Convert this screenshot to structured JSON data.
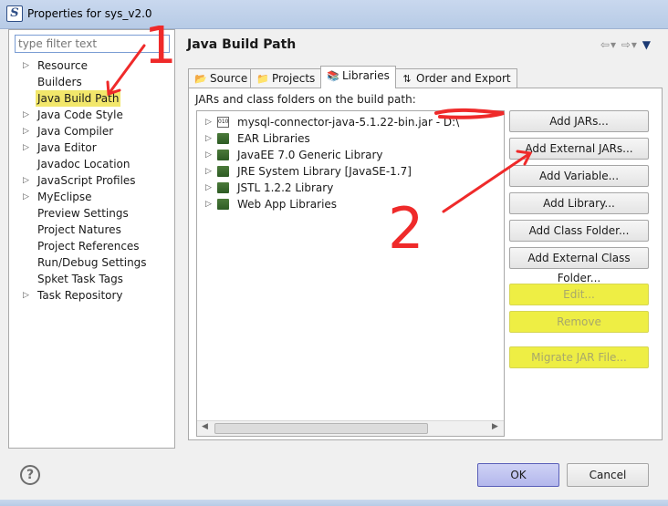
{
  "window": {
    "title": "Properties for sys_v2.0"
  },
  "filter": {
    "placeholder": "type filter text"
  },
  "tree": [
    {
      "label": "Resource",
      "expandable": true
    },
    {
      "label": "Builders",
      "expandable": false
    },
    {
      "label": "Java Build Path",
      "expandable": false,
      "selected": true
    },
    {
      "label": "Java Code Style",
      "expandable": true
    },
    {
      "label": "Java Compiler",
      "expandable": true
    },
    {
      "label": "Java Editor",
      "expandable": true
    },
    {
      "label": "Javadoc Location",
      "expandable": false
    },
    {
      "label": "JavaScript Profiles",
      "expandable": true
    },
    {
      "label": "MyEclipse",
      "expandable": true
    },
    {
      "label": "Preview Settings",
      "expandable": false
    },
    {
      "label": "Project Natures",
      "expandable": false
    },
    {
      "label": "Project References",
      "expandable": false
    },
    {
      "label": "Run/Debug Settings",
      "expandable": false
    },
    {
      "label": "Spket Task Tags",
      "expandable": false
    },
    {
      "label": "Task Repository",
      "expandable": true
    }
  ],
  "page": {
    "title": "Java Build Path"
  },
  "tabs": [
    {
      "label": "Source",
      "icon": "source-folder-icon"
    },
    {
      "label": "Projects",
      "icon": "projects-icon"
    },
    {
      "label": "Libraries",
      "icon": "libraries-icon",
      "active": true
    },
    {
      "label": "Order and Export",
      "icon": "order-export-icon"
    }
  ],
  "libraries": {
    "caption": "JARs and class folders on the build path:",
    "items": [
      {
        "label": "mysql-connector-java-5.1.22-bin.jar - D:\\",
        "icon": "jar-icon"
      },
      {
        "label": "EAR Libraries",
        "icon": "library-icon"
      },
      {
        "label": "JavaEE 7.0 Generic Library",
        "icon": "library-icon"
      },
      {
        "label": "JRE System Library [JavaSE-1.7]",
        "icon": "library-icon"
      },
      {
        "label": "JSTL 1.2.2 Library",
        "icon": "library-icon"
      },
      {
        "label": "Web App Libraries",
        "icon": "library-icon"
      }
    ]
  },
  "buttons": {
    "add_jars": "Add JARs...",
    "add_external_jars": "Add External JARs...",
    "add_variable": "Add Variable...",
    "add_library": "Add Library...",
    "add_class_folder": "Add Class Folder...",
    "add_external_class_folder": "Add External Class Folder...",
    "edit": "Edit...",
    "remove": "Remove",
    "migrate_jar": "Migrate JAR File..."
  },
  "footer": {
    "ok": "OK",
    "cancel": "Cancel",
    "help": "?"
  },
  "annotations": {
    "step1": "1",
    "step2": "2",
    "color": "#ef2a2a"
  }
}
